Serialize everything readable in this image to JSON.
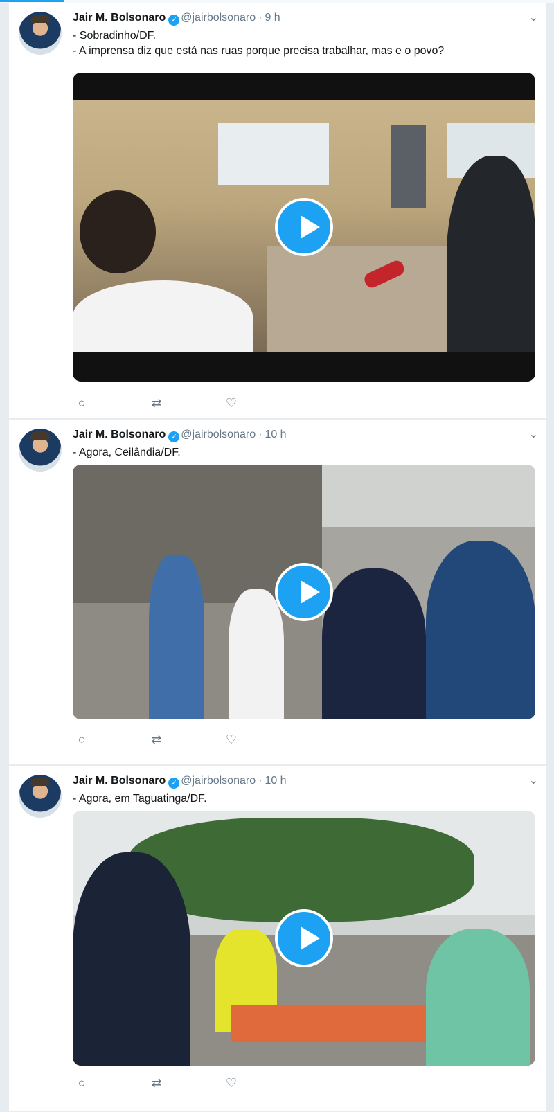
{
  "icons": {
    "verified": "verified-badge-icon",
    "reply": "reply-icon",
    "retweet": "retweet-icon",
    "like": "heart-icon",
    "caret": "chevron-down-icon",
    "play": "play-icon"
  },
  "colors": {
    "accent": "#1da1f2",
    "name": "#14171a",
    "meta": "#657786",
    "feed_bg": "#e6ecf0"
  },
  "tweets": [
    {
      "name": "Jair M. Bolsonaro",
      "handle": "@jairbolsonaro",
      "separator": "·",
      "time": "9 h",
      "line1": "- Sobradinho/DF.",
      "line2": "- A imprensa diz que está nas ruas porque precisa trabalhar, mas e o povo?"
    },
    {
      "name": "Jair M. Bolsonaro",
      "handle": "@jairbolsonaro",
      "separator": "·",
      "time": "10 h",
      "line1": "- Agora, Ceilândia/DF.",
      "line2": ""
    },
    {
      "name": "Jair M. Bolsonaro",
      "handle": "@jairbolsonaro",
      "separator": "·",
      "time": "10 h",
      "line1": "- Agora, em Taguatinga/DF.",
      "line2": ""
    }
  ]
}
